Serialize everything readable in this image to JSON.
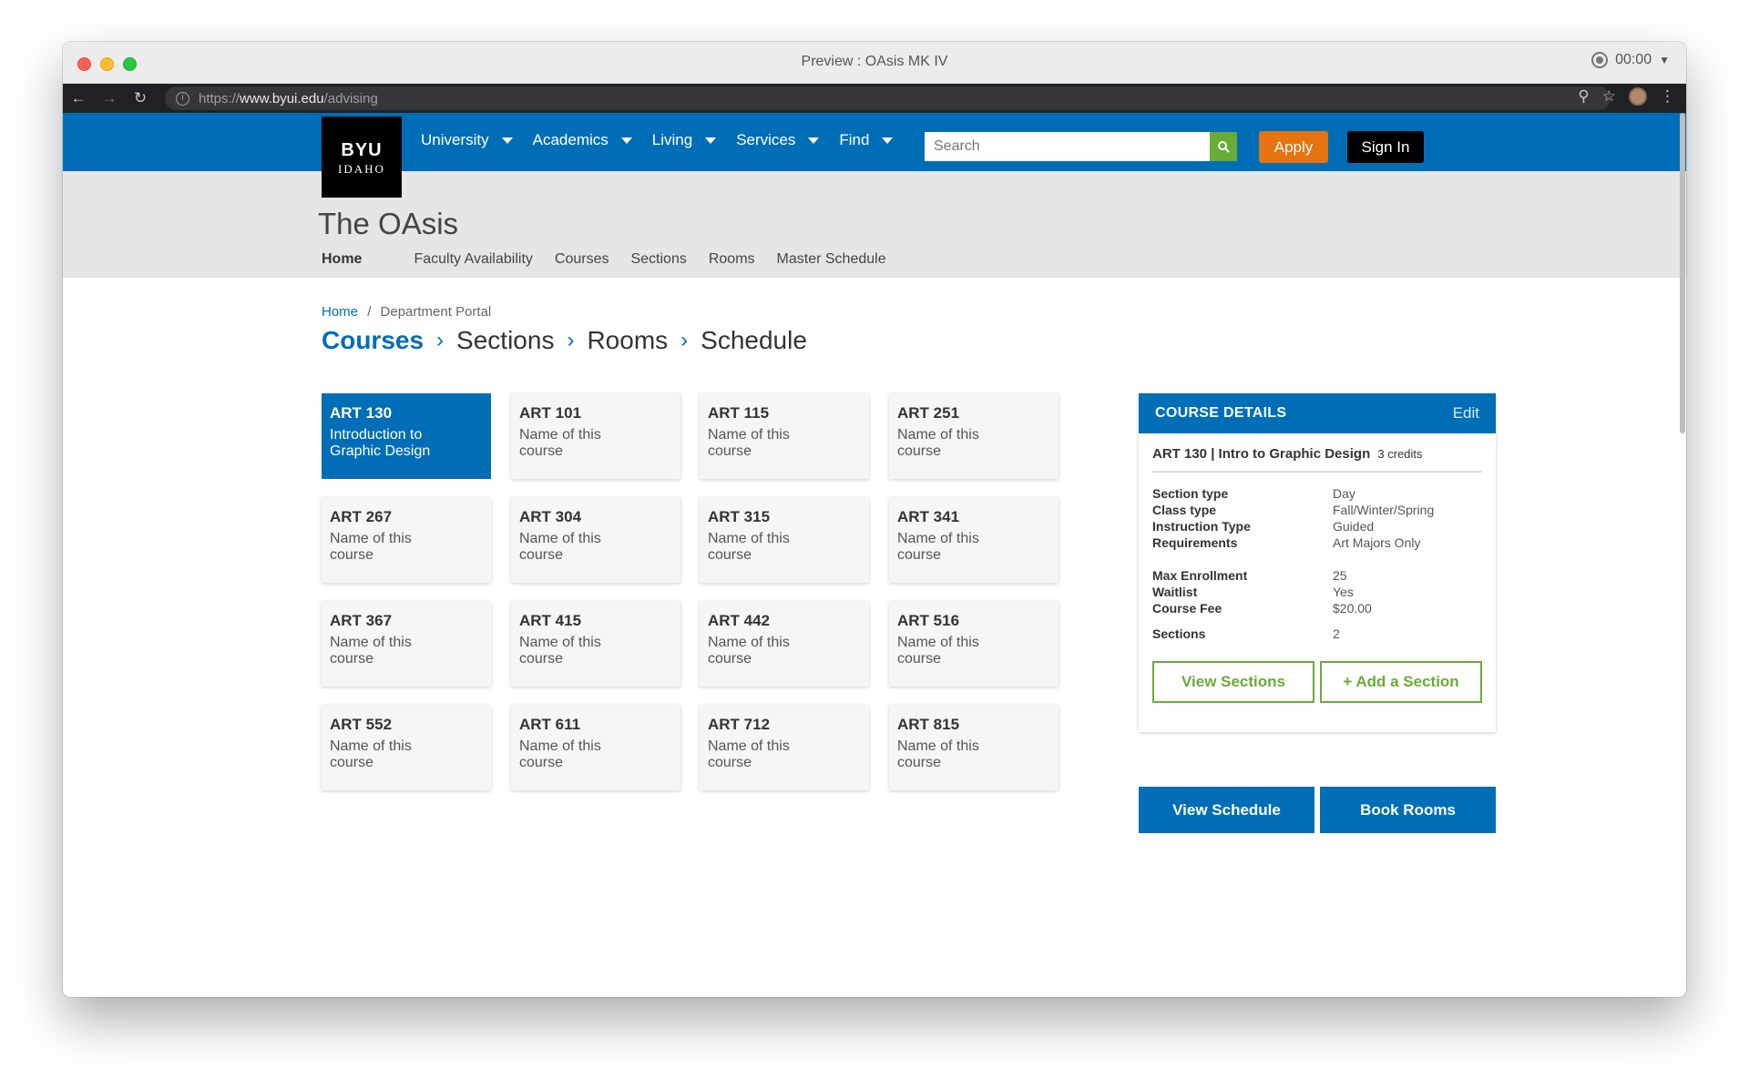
{
  "window": {
    "title": "Preview : OAsis MK IV",
    "timer": "00:00"
  },
  "browser": {
    "url_scheme": "https://",
    "url_host": "www.byui.edu",
    "url_path": "/advising"
  },
  "header": {
    "logo_top": "BYU",
    "logo_bottom": "IDAHO",
    "nav": [
      "University",
      "Academics",
      "Living",
      "Services",
      "Find"
    ],
    "search_placeholder": "Search",
    "apply_label": "Apply",
    "signin_label": "Sign In"
  },
  "band": {
    "title": "The OAsis",
    "subnav": [
      "Home",
      "Faculty Availability",
      "Courses",
      "Sections",
      "Rooms",
      "Master Schedule"
    ]
  },
  "breadcrumb": {
    "home": "Home",
    "separator": "/",
    "current": "Department Portal"
  },
  "steps": [
    "Courses",
    "Sections",
    "Rooms",
    "Schedule"
  ],
  "courses": [
    {
      "code": "ART 130",
      "name": "Introduction to Graphic Design",
      "selected": true
    },
    {
      "code": "ART 101",
      "name": "Name of this course"
    },
    {
      "code": "ART 115",
      "name": "Name of this course"
    },
    {
      "code": "ART 251",
      "name": "Name of this course"
    },
    {
      "code": "ART 267",
      "name": "Name of this course"
    },
    {
      "code": "ART 304",
      "name": "Name of this course"
    },
    {
      "code": "ART 315",
      "name": "Name of this course"
    },
    {
      "code": "ART 341",
      "name": "Name of this course"
    },
    {
      "code": "ART 367",
      "name": "Name of this course"
    },
    {
      "code": "ART 415",
      "name": "Name of this course"
    },
    {
      "code": "ART 442",
      "name": "Name of this course"
    },
    {
      "code": "ART 516",
      "name": "Name of this course"
    },
    {
      "code": "ART 552",
      "name": "Name of this course"
    },
    {
      "code": "ART 611",
      "name": "Name of this course"
    },
    {
      "code": "ART 712",
      "name": "Name of this course"
    },
    {
      "code": "ART 815",
      "name": "Name of this course"
    }
  ],
  "details": {
    "heading": "COURSE DETAILS",
    "edit": "Edit",
    "course": "ART 130 | Intro to Graphic Design",
    "credits": "3 credits",
    "section_type_k": "Section type",
    "section_type_v": "Day",
    "class_type_k": "Class type",
    "class_type_v": "Fall/Winter/Spring",
    "instruction_k": "Instruction Type",
    "instruction_v": "Guided",
    "requirements_k": "Requirements",
    "requirements_v": "Art Majors Only",
    "max_enroll_k": "Max Enrollment",
    "max_enroll_v": "25",
    "waitlist_k": "Waitlist",
    "waitlist_v": "Yes",
    "fee_k": "Course Fee",
    "fee_v": "$20.00",
    "sections_k": "Sections",
    "sections_v": "2",
    "view_sections": "View Sections",
    "add_section": "+ Add a Section"
  },
  "actions": {
    "view_schedule": "View Schedule",
    "book_rooms": "Book Rooms"
  },
  "colors": {
    "brand_blue": "#006eb6",
    "apply_orange": "#e5730f",
    "accent_green": "#6aab38"
  }
}
